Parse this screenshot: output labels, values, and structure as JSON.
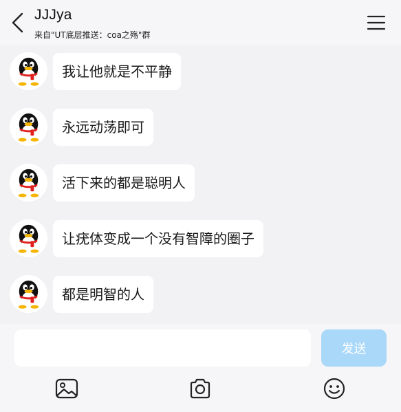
{
  "header": {
    "title": "JJJya",
    "subtitle": "来自\"UT底层推送：coa之殇\"群",
    "back_icon": "chevron-left-icon",
    "menu_icon": "hamburger-menu-icon"
  },
  "messages": [
    {
      "text": "我让他就是不平静",
      "avatar": "penguin-avatar"
    },
    {
      "text": "永远动荡即可",
      "avatar": "penguin-avatar"
    },
    {
      "text": "活下来的都是聪明人",
      "avatar": "penguin-avatar"
    },
    {
      "text": "让疣体变成一个没有智障的圈子",
      "avatar": "penguin-avatar"
    },
    {
      "text": "都是明智的人",
      "avatar": "penguin-avatar"
    }
  ],
  "composer": {
    "input_value": "",
    "send_label": "发送",
    "tools": [
      "image-icon",
      "camera-icon",
      "emoji-icon"
    ]
  },
  "colors": {
    "background": "#f2f2f4",
    "bubble": "#ffffff",
    "send_button": "#a9d8f9"
  }
}
